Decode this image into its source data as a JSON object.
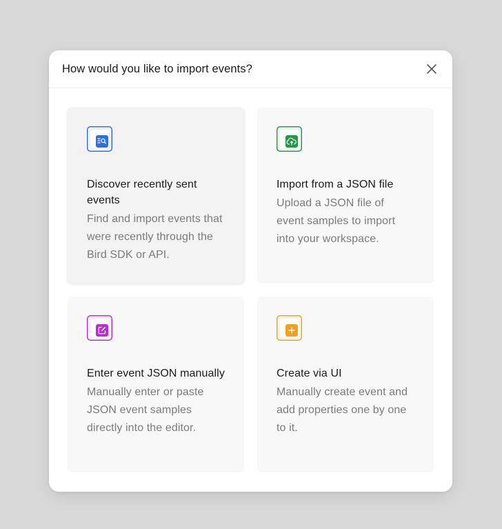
{
  "dialog": {
    "title": "How would you like to import events?",
    "close_icon": "close-icon"
  },
  "options": [
    {
      "title": "Discover recently sent events",
      "description": "Find and import events that were recently through the Bird SDK or API.",
      "icon": "search-list-icon",
      "color": "#2f6fdb"
    },
    {
      "title": "Import from a JSON file",
      "description": "Upload a JSON file of event samples to import into your workspace.",
      "icon": "cloud-upload-icon",
      "color": "#1f9a45"
    },
    {
      "title": "Enter event JSON manually",
      "description": "Manually enter or paste JSON event samples directly into the editor.",
      "icon": "edit-icon",
      "color": "#b532c9"
    },
    {
      "title": "Create via UI",
      "description": "Manually create event and add properties one by one to it.",
      "icon": "plus-icon",
      "color": "#f0a020"
    }
  ]
}
